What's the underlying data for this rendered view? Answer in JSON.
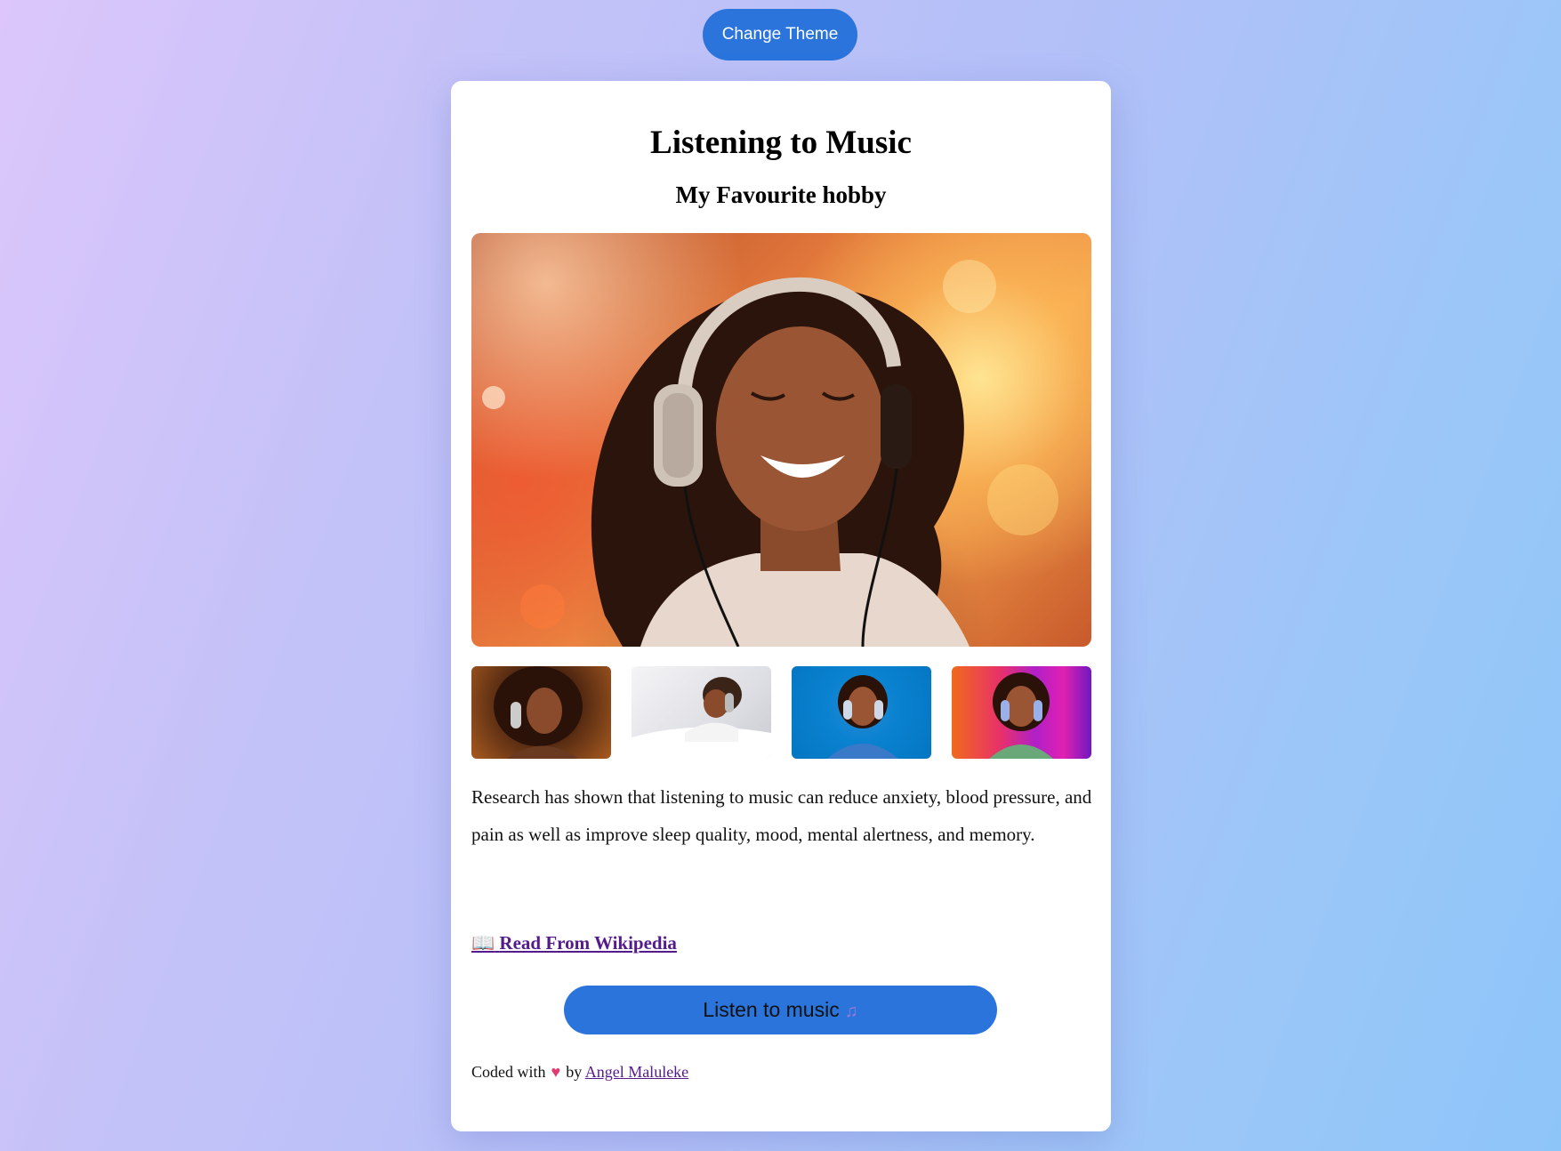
{
  "theme_button": {
    "label": "Change Theme"
  },
  "card": {
    "title": "Listening to Music",
    "subtitle": "My Favourite hobby",
    "paragraph": "Research has shown that listening to music can reduce anxiety, blood pressure, and pain as well as improve sleep quality, mood, mental alertness, and memory.",
    "wiki_link": {
      "icon": "open-book-icon",
      "label": "Read From Wikipedia"
    },
    "listen_button": {
      "label": "Listen to music",
      "icon": "music-note-icon"
    },
    "footer": {
      "prefix": "Coded with",
      "icon": "heart-icon",
      "by": "by",
      "author": "Angel Maluleke"
    }
  },
  "colors": {
    "accent": "#2a74dc",
    "link": "#551a8b",
    "heart": "#e03a6e"
  }
}
